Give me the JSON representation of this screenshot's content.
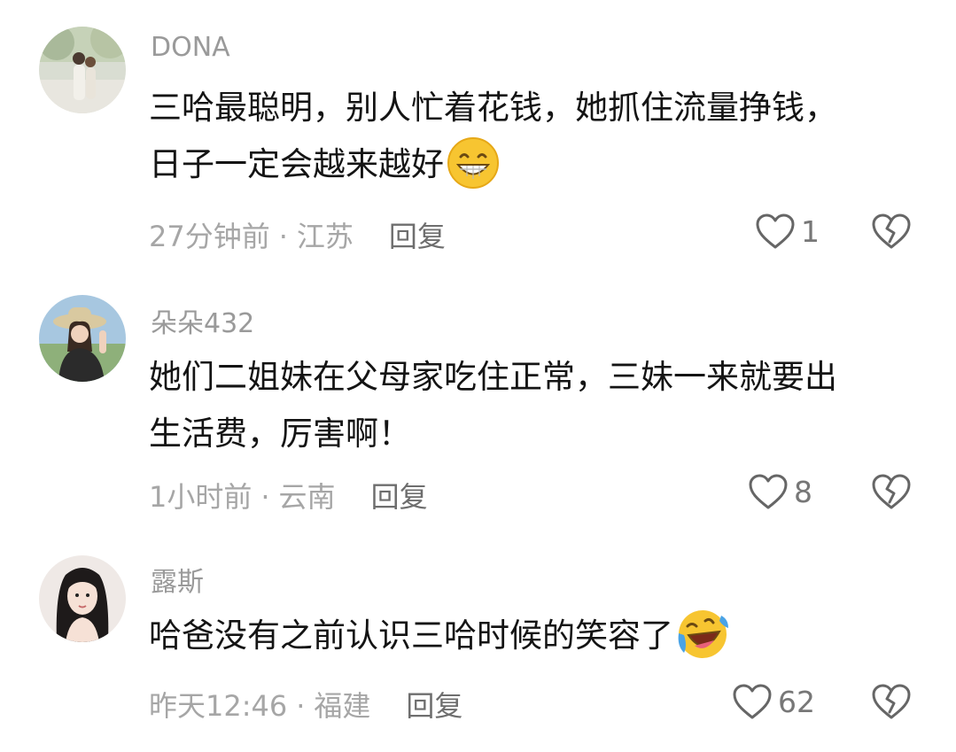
{
  "comments": [
    {
      "username": "DONA",
      "text_line1": "三哈最聪明，别人忙着花钱，她抓住流量挣钱，",
      "text_line2": "日子一定会越来越好",
      "emoji": "grinning-face-icon",
      "time": "27分钟前",
      "dot": "·",
      "location": "江苏",
      "reply_label": "回复",
      "like_count": "1"
    },
    {
      "username": "朵朵432",
      "text_line1": "她们二姐妹在父母家吃住正常，三妹一来就要出",
      "text_line2": "生活费，厉害啊！",
      "time": "1小时前",
      "dot": "·",
      "location": "云南",
      "reply_label": "回复",
      "like_count": "8"
    },
    {
      "username": "露斯",
      "text_line1": "哈爸没有之前认识三哈时候的笑容了",
      "emoji": "laughing-crying-face-icon",
      "time": "昨天12:46",
      "dot": "·",
      "location": "福建",
      "reply_label": "回复",
      "like_count": "62"
    }
  ],
  "colors": {
    "username": "#9a9a9a",
    "text": "#141414",
    "meta": "#a6a6a6",
    "reply": "#6e6e6e",
    "icon_stroke": "#666666",
    "emoji_yellow": "#f7c531"
  }
}
